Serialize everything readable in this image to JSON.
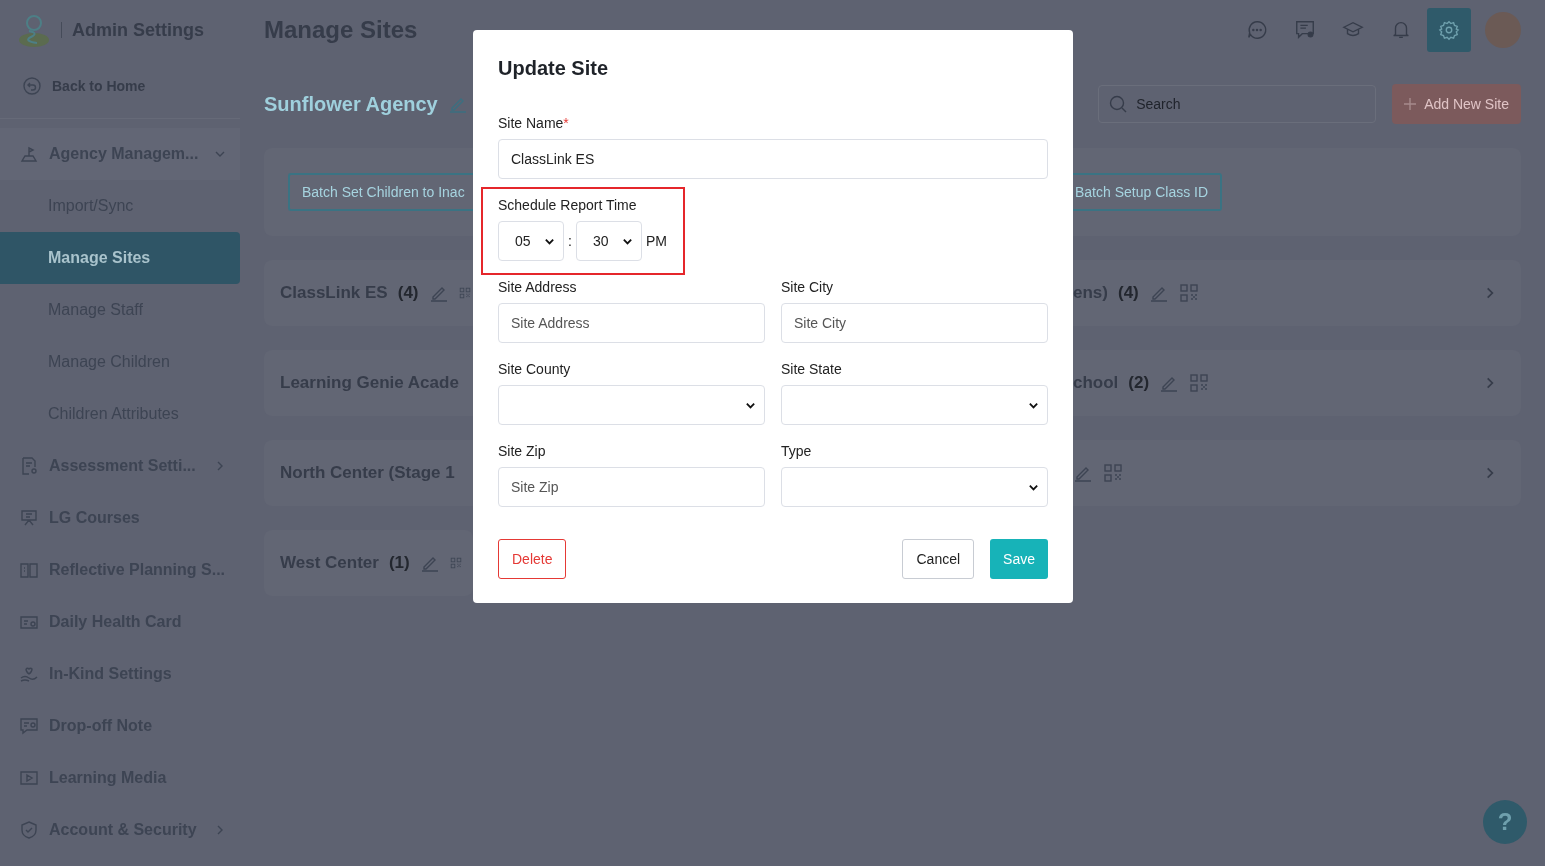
{
  "header": {
    "app_title": "Admin Settings",
    "page_title": "Manage Sites"
  },
  "toolbar_icons": [
    {
      "selected": false
    },
    {
      "selected": false
    },
    {
      "selected": false
    },
    {
      "selected": false
    },
    {
      "selected": true
    }
  ],
  "sidebar": {
    "back_link": "Back to Home",
    "items": [
      {
        "label": "Agency Managem...",
        "expandable": true,
        "expanded": true,
        "children": [
          {
            "label": "Import/Sync",
            "selected": false
          },
          {
            "label": "Manage Sites",
            "selected": true
          },
          {
            "label": "Manage Staff",
            "selected": false
          },
          {
            "label": "Manage Children",
            "selected": false
          },
          {
            "label": "Children Attributes",
            "selected": false
          }
        ]
      },
      {
        "label": "Assessment Setti...",
        "expandable": true,
        "expanded": false
      },
      {
        "label": "LG Courses",
        "expandable": false
      },
      {
        "label": "Reflective Planning S...",
        "expandable": false
      },
      {
        "label": "Daily Health Card",
        "expandable": false
      },
      {
        "label": "In-Kind Settings",
        "expandable": false
      },
      {
        "label": "Drop-off Note",
        "expandable": false
      },
      {
        "label": "Learning Media",
        "expandable": false
      },
      {
        "label": "Account & Security",
        "expandable": true,
        "expanded": false
      }
    ]
  },
  "agency": {
    "name": "Sunflower Agency"
  },
  "search": {
    "placeholder": "Search"
  },
  "add_button": {
    "label": "Add New Site"
  },
  "batch_buttons": [
    {
      "label": "Batch Set Children to Inac"
    },
    {
      "label": "Batch Setup Class ID"
    }
  ],
  "sites": [
    {
      "name": "ClassLink ES",
      "count": "(4)",
      "continues_right": true,
      "right_name": "ens)",
      "right_count": "(4)"
    },
    {
      "name": "Learning Genie Acade",
      "continues_right": true,
      "right_name": "chool",
      "right_count": "(2)"
    },
    {
      "name": "North Center (Stage 1",
      "continues_right": true
    },
    {
      "name": "West Center",
      "count": "(1)",
      "continues_right": false
    }
  ],
  "dialog": {
    "title": "Update Site",
    "rows": [
      [
        {
          "kind": "text",
          "label": "Site Name",
          "required_mark": "*",
          "value": "ClassLink ES"
        }
      ],
      [
        {
          "kind": "time",
          "label": "Schedule Report Time",
          "hour": "05",
          "separator": ":",
          "minute": "30",
          "period": "PM",
          "highlighted": true
        }
      ],
      [
        {
          "kind": "text",
          "label": "Site Address",
          "placeholder": "Site Address"
        },
        {
          "kind": "text",
          "label": "Site City",
          "placeholder": "Site City"
        }
      ],
      [
        {
          "kind": "select",
          "label": "Site County"
        },
        {
          "kind": "select",
          "label": "Site State"
        }
      ],
      [
        {
          "kind": "text",
          "label": "Site Zip",
          "placeholder": "Site Zip"
        },
        {
          "kind": "select",
          "label": "Type"
        }
      ]
    ],
    "buttons": [
      {
        "label": "Delete",
        "kind": "danger"
      },
      {
        "label": "Cancel",
        "kind": "default"
      },
      {
        "label": "Save",
        "kind": "primary"
      }
    ]
  },
  "help_button": {
    "label": "?"
  }
}
